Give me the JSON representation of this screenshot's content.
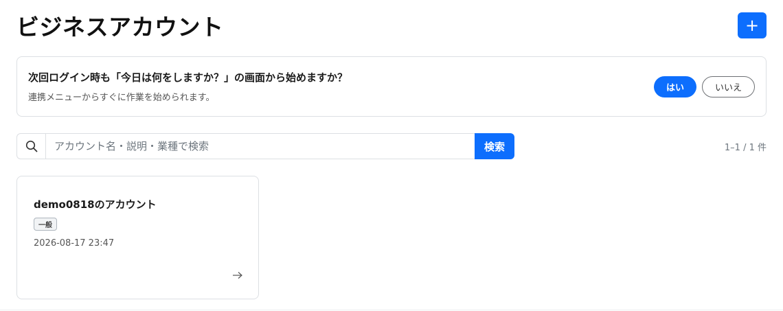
{
  "header": {
    "title": "ビジネスアカウント",
    "add_label": "+"
  },
  "prompt": {
    "question": "次回ログイン時も「今日は何をしますか？」の画面から始めますか？",
    "subtext": "連携メニューからすぐに作業を始められます。",
    "yes_label": "はい",
    "no_label": "いいえ"
  },
  "search": {
    "placeholder": "アカウント名・説明・業種で検索",
    "value": "",
    "button_label": "検索",
    "result_count": "1–1 / 1 件"
  },
  "accounts": [
    {
      "name": "demo0818のアカウント",
      "badge": "一般",
      "date": "2026-08-17 23:47"
    }
  ],
  "colors": {
    "accent": "#0d6efd",
    "border": "#dcdfe3",
    "muted_text": "#6c757d"
  },
  "icons": {
    "search": "search-icon",
    "add": "plus-icon",
    "open": "arrow-right-icon"
  }
}
